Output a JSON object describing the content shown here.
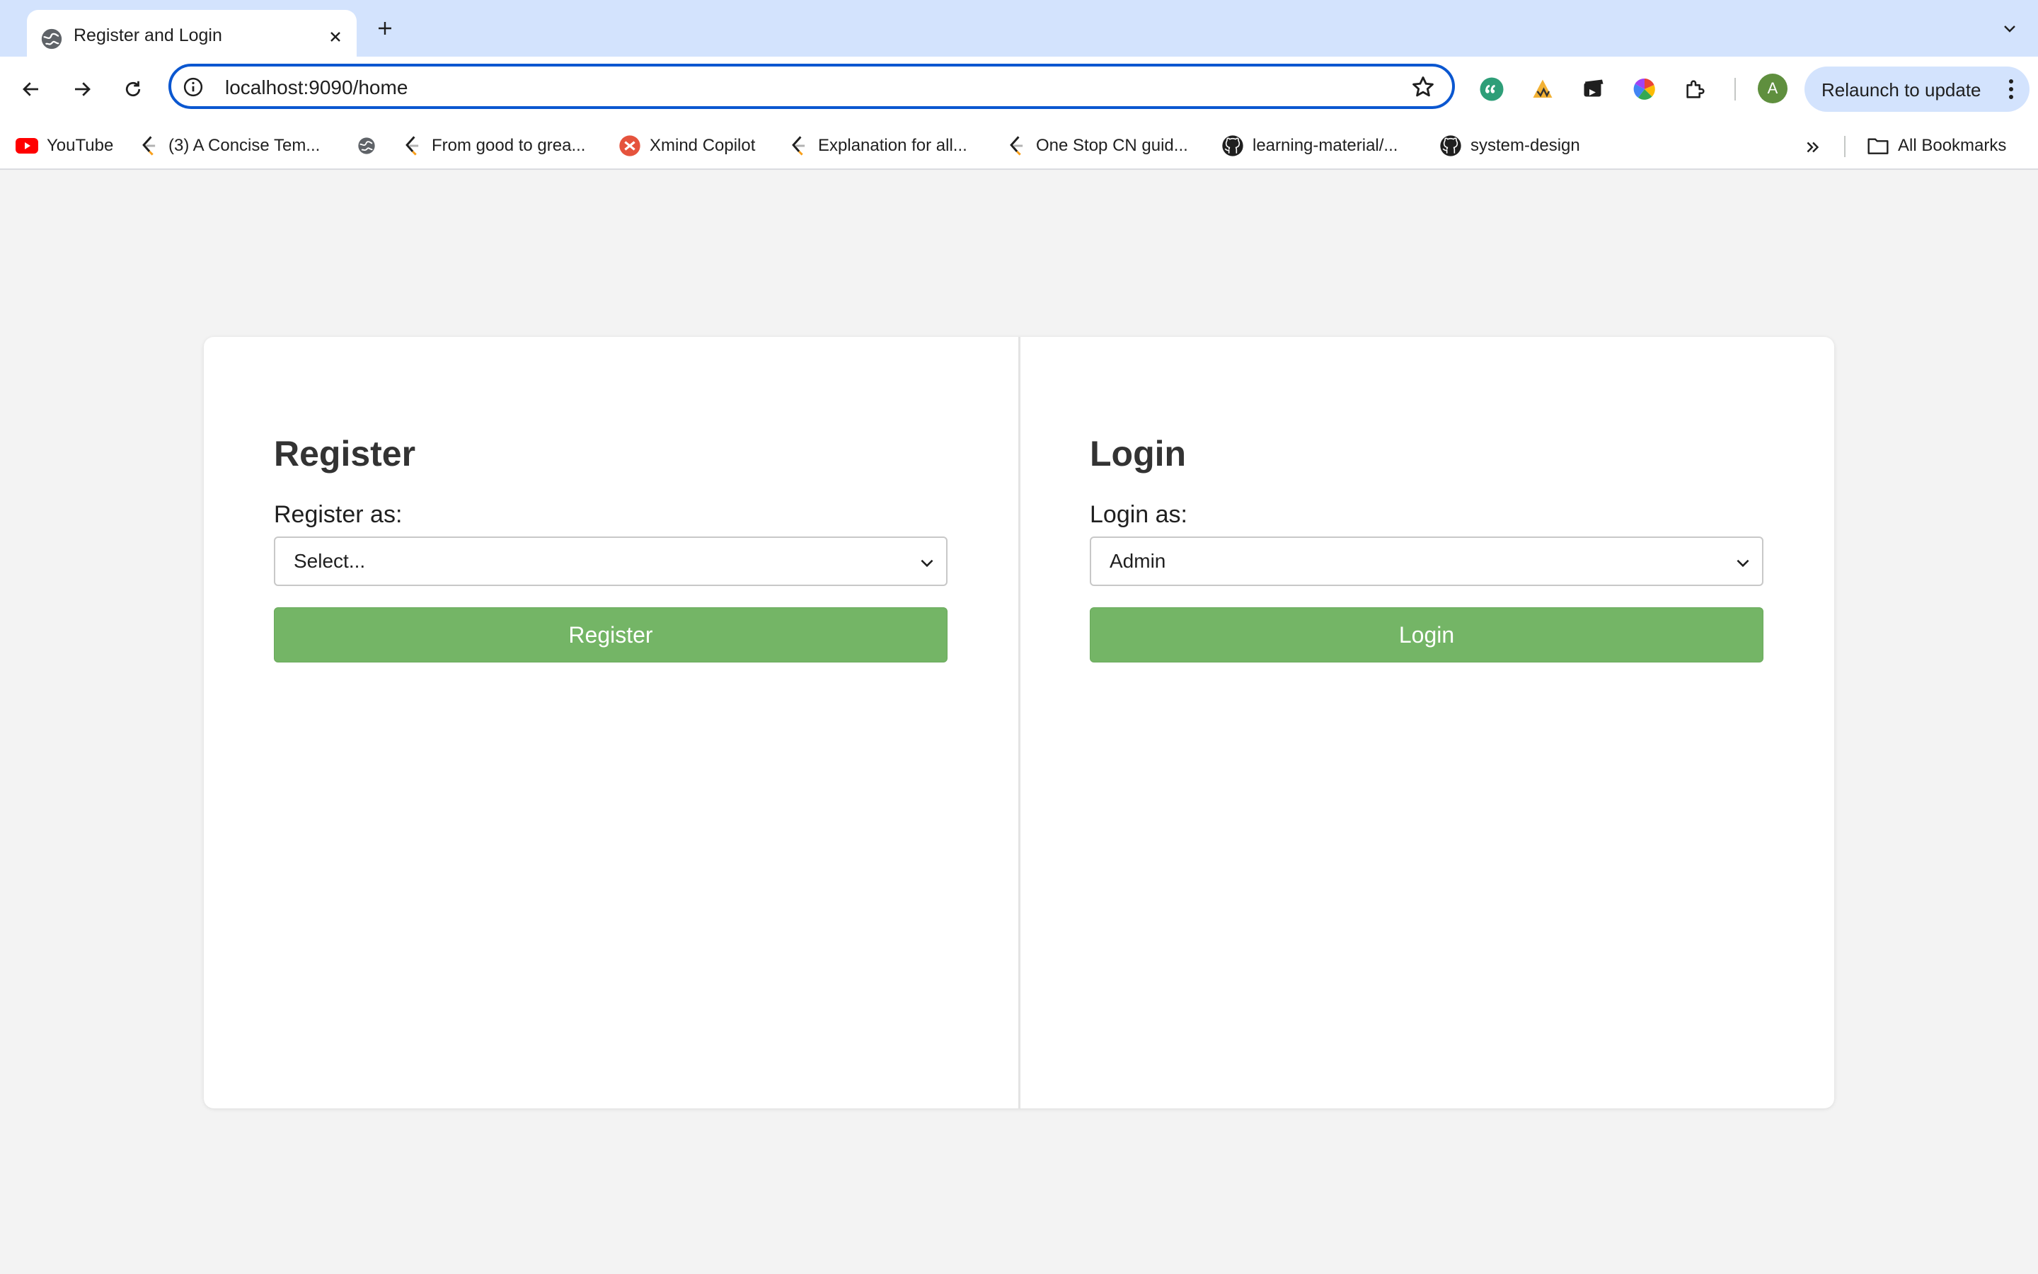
{
  "browser": {
    "tab": {
      "title": "Register and Login"
    },
    "address_bar": {
      "url": "localhost:9090/home"
    },
    "relaunch_label": "Relaunch to update",
    "profile_initial": "A",
    "bookmarks": [
      {
        "label": "YouTube",
        "icon": "youtube-icon"
      },
      {
        "label": "(3) A Concise Tem...",
        "icon": "leetcode-icon"
      },
      {
        "label": "",
        "icon": "globe-icon"
      },
      {
        "label": "From good to grea...",
        "icon": "leetcode-icon"
      },
      {
        "label": "Xmind Copilot",
        "icon": "xmind-icon"
      },
      {
        "label": "Explanation for all...",
        "icon": "leetcode-icon"
      },
      {
        "label": "One Stop CN guid...",
        "icon": "leetcode-icon"
      },
      {
        "label": "learning-material/...",
        "icon": "github-icon"
      },
      {
        "label": "system-design",
        "icon": "github-icon"
      }
    ],
    "all_bookmarks_label": "All Bookmarks"
  },
  "register": {
    "heading": "Register",
    "label": "Register as:",
    "selected": "Select...",
    "button": "Register"
  },
  "login": {
    "heading": "Login",
    "label": "Login as:",
    "selected": "Admin",
    "button": "Login"
  },
  "colors": {
    "button_green": "#74b566",
    "heading_text": "#333333",
    "page_background": "#f3f3f3",
    "tabstrip": "#d3e3fd",
    "omnibox_focus": "#0b57d0"
  }
}
